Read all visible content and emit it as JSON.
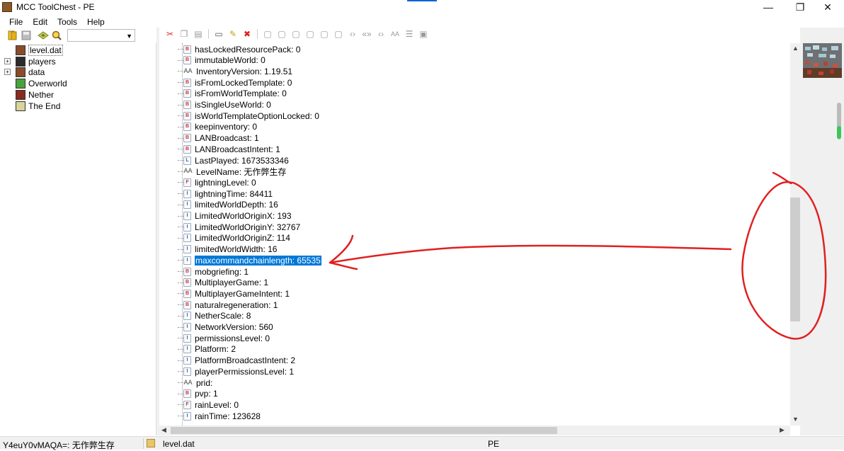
{
  "window": {
    "title": "MCC ToolChest - PE",
    "minimize_glyph": "—",
    "maximize_glyph": "❐",
    "close_glyph": "✕"
  },
  "menu": [
    "File",
    "Edit",
    "Tools",
    "Help"
  ],
  "toolbar": {
    "combo_value": "",
    "icons": [
      "open-folder-icon",
      "save-icon",
      "map-icon",
      "search-icon"
    ]
  },
  "edit_toolbar_icons": [
    "cut-icon",
    "copy-icon",
    "paste-icon",
    "rename-icon",
    "edit-icon",
    "delete-icon",
    "add-byte-icon",
    "add-short-icon",
    "add-int-icon",
    "add-long-icon",
    "add-float-icon",
    "add-double-icon",
    "add-byte-array-icon",
    "add-int-array-icon",
    "add-long-array-icon",
    "add-string-icon",
    "add-list-icon",
    "add-compound-icon"
  ],
  "tree": [
    {
      "label": "level.dat",
      "icon": "book-icon",
      "selected": true,
      "expander": false,
      "color": "#8a4b2a"
    },
    {
      "label": "players",
      "icon": "player-block-icon",
      "selected": false,
      "expander": true,
      "color": "#2b2b2b"
    },
    {
      "label": "data",
      "icon": "book-icon",
      "selected": false,
      "expander": true,
      "color": "#8a4b2a"
    },
    {
      "label": "Overworld",
      "icon": "grass-block-icon",
      "selected": false,
      "expander": false,
      "color": "#4aa23c"
    },
    {
      "label": "Nether",
      "icon": "netherrack-block-icon",
      "selected": false,
      "expander": false,
      "color": "#8a2b20"
    },
    {
      "label": "The End",
      "icon": "endstone-block-icon",
      "selected": false,
      "expander": false,
      "color": "#d8d49a"
    }
  ],
  "nbt_rows": [
    {
      "type": "B",
      "text": "hasLockedResourcePack: 0"
    },
    {
      "type": "B",
      "text": "immutableWorld: 0"
    },
    {
      "type": "S",
      "text": "InventoryVersion: 1.19.51"
    },
    {
      "type": "B",
      "text": "isFromLockedTemplate: 0"
    },
    {
      "type": "B",
      "text": "isFromWorldTemplate: 0"
    },
    {
      "type": "B",
      "text": "isSingleUseWorld: 0"
    },
    {
      "type": "B",
      "text": "isWorldTemplateOptionLocked: 0"
    },
    {
      "type": "B",
      "text": "keepinventory: 0"
    },
    {
      "type": "B",
      "text": "LANBroadcast: 1"
    },
    {
      "type": "B",
      "text": "LANBroadcastIntent: 1"
    },
    {
      "type": "L",
      "text": "LastPlayed: 1673533346"
    },
    {
      "type": "S",
      "text": "LevelName: 无作弊生存"
    },
    {
      "type": "F",
      "text": "lightningLevel: 0"
    },
    {
      "type": "I",
      "text": "lightningTime: 84411"
    },
    {
      "type": "I",
      "text": "limitedWorldDepth: 16"
    },
    {
      "type": "I",
      "text": "LimitedWorldOriginX: 193"
    },
    {
      "type": "I",
      "text": "LimitedWorldOriginY: 32767"
    },
    {
      "type": "I",
      "text": "LimitedWorldOriginZ: 114"
    },
    {
      "type": "I",
      "text": "limitedWorldWidth: 16"
    },
    {
      "type": "I",
      "text": "maxcommandchainlength: 65535",
      "selected": true
    },
    {
      "type": "B",
      "text": "mobgriefing: 1"
    },
    {
      "type": "B",
      "text": "MultiplayerGame: 1"
    },
    {
      "type": "B",
      "text": "MultiplayerGameIntent: 1"
    },
    {
      "type": "B",
      "text": "naturalregeneration: 1"
    },
    {
      "type": "I",
      "text": "NetherScale: 8"
    },
    {
      "type": "I",
      "text": "NetworkVersion: 560"
    },
    {
      "type": "I",
      "text": "permissionsLevel: 0"
    },
    {
      "type": "I",
      "text": "Platform: 2"
    },
    {
      "type": "I",
      "text": "PlatformBroadcastIntent: 2"
    },
    {
      "type": "I",
      "text": "playerPermissionsLevel: 1"
    },
    {
      "type": "S",
      "text": "prid:"
    },
    {
      "type": "B",
      "text": "pvp: 1"
    },
    {
      "type": "F",
      "text": "rainLevel: 0"
    },
    {
      "type": "I",
      "text": "rainTime: 123628"
    }
  ],
  "status": {
    "key": "Y4euY0vMAQA=: 无作弊生存",
    "file": "level.dat",
    "mode": "PE"
  },
  "colors": {
    "selection": "#0078d7",
    "annotation": "#e02020"
  }
}
